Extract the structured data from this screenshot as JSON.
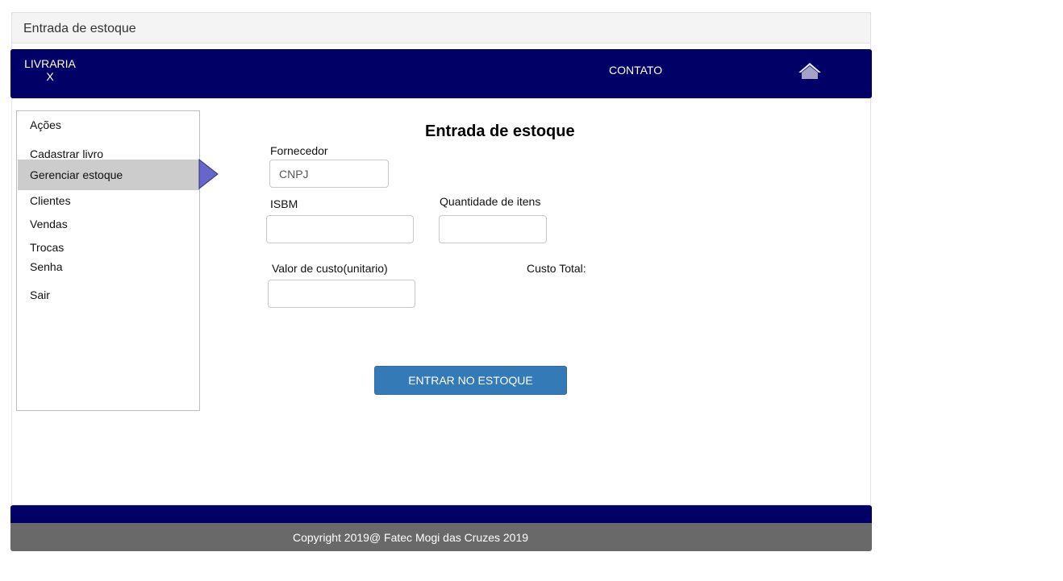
{
  "window": {
    "title": "Entrada de estoque"
  },
  "navbar": {
    "brand_line1": "LIVRARIA",
    "brand_line2": "X",
    "contact_label": "CONTATO",
    "home_icon": "home-icon",
    "background": "#000066"
  },
  "sidebar": {
    "heading": "Ações",
    "items": [
      {
        "label": "Cadastrar livro",
        "active": false
      },
      {
        "label": "Gerenciar estoque",
        "active": true
      },
      {
        "label": "Clientes",
        "active": false
      },
      {
        "label": "Vendas",
        "active": false
      },
      {
        "label": "Trocas",
        "active": false
      },
      {
        "label": "Senha",
        "active": false
      },
      {
        "label": "Sair",
        "active": false
      }
    ],
    "active_color": "#cccccc",
    "pointer_color": "#6666cc"
  },
  "form": {
    "title": "Entrada de estoque",
    "fornecedor_label": "Fornecedor",
    "fornecedor_placeholder": "CNPJ",
    "fornecedor_value": "",
    "isbm_label": "ISBM",
    "isbm_value": "",
    "quantidade_label": "Quantidade de itens",
    "quantidade_value": "",
    "valor_label": "Valor de custo(unitario)",
    "valor_value": "",
    "custo_total_label": "Custo Total:",
    "submit_label": "ENTRAR NO ESTOQUE",
    "submit_color": "#337ab7"
  },
  "footer": {
    "copyright": "Copyright 2019@ Fatec Mogi das Cruzes 2019",
    "background": "#696969"
  }
}
